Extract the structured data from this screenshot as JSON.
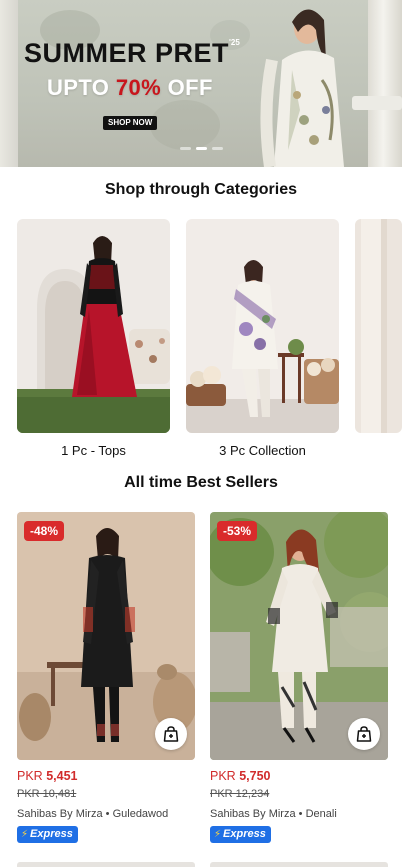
{
  "banner": {
    "title": "SUMMER PRET",
    "title_sup": "'25",
    "offer_prefix": "UPTO",
    "offer_percent": "70%",
    "offer_suffix": "OFF",
    "button_label": "SHOP NOW",
    "slides_total": 3,
    "active_slide": 2
  },
  "categories": {
    "heading": "Shop through Categories",
    "items": [
      {
        "label": "1 Pc - Tops"
      },
      {
        "label": "3 Pc Collection"
      }
    ]
  },
  "best_sellers": {
    "heading": "All time Best Sellers",
    "products": [
      {
        "discount": "-48%",
        "currency": "PKR",
        "price": "5,451",
        "old_price": "PKR 10,481",
        "brand": "Sahibas By Mirza",
        "collection": "Guledawod",
        "delivery": "Express"
      },
      {
        "discount": "-53%",
        "currency": "PKR",
        "price": "5,750",
        "old_price": "PKR 12,234",
        "brand": "Sahibas By Mirza",
        "collection": "Denali",
        "delivery": "Express"
      }
    ]
  },
  "colors": {
    "discount_badge": "#d92b2b",
    "price": "#d12b2b",
    "express_badge": "#1f6fe5",
    "offer_accent": "#c8161d"
  },
  "icons": {
    "cart": "add-to-bag-icon",
    "express": "lightning-bolt-icon"
  }
}
